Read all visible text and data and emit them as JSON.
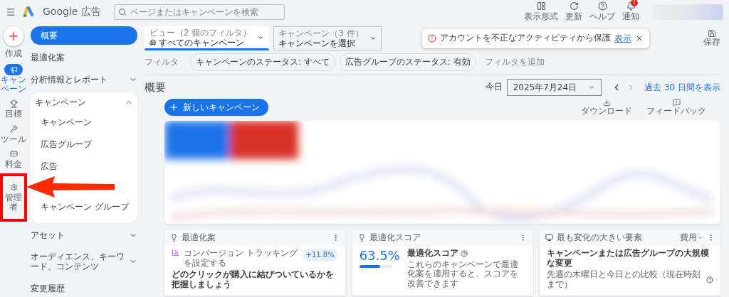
{
  "header": {
    "brand": "Google 広告",
    "search_placeholder": "ページまたはキャンペーンを検索",
    "actions": [
      {
        "label": "表示形式"
      },
      {
        "label": "更新"
      },
      {
        "label": "ヘルプ"
      },
      {
        "label": "通知",
        "badge": "!"
      }
    ]
  },
  "create": {
    "label": "作成"
  },
  "rail": [
    {
      "label": "キャンペーン",
      "selected": true,
      "annotated": false
    },
    {
      "label": "目標",
      "selected": false,
      "annotated": false
    },
    {
      "label": "ツール",
      "selected": false,
      "annotated": false
    },
    {
      "label": "料金",
      "selected": false,
      "annotated": false
    },
    {
      "label": "管理者",
      "selected": false,
      "annotated": true
    }
  ],
  "nav": [
    {
      "label": "概要",
      "kind": "item",
      "selected": true
    },
    {
      "label": "最適化案",
      "kind": "item",
      "selected": false
    },
    {
      "label": "分析情報とレポート",
      "kind": "group",
      "expanded": false,
      "selected": false
    },
    {
      "label": "キャンペーン",
      "kind": "group",
      "expanded": true,
      "selected": false,
      "children": [
        {
          "label": "キャンペーン",
          "selected": false
        },
        {
          "label": "広告グループ",
          "selected": false
        },
        {
          "label": "広告",
          "selected": false
        },
        {
          "label": "キャンペーン グループ",
          "selected": false
        }
      ]
    },
    {
      "label": "アセット",
      "kind": "group",
      "expanded": false,
      "selected": false
    },
    {
      "label": "オーディエンス、キーワード、コンテンツ",
      "kind": "group",
      "expanded": false,
      "selected": false
    },
    {
      "label": "変更履歴",
      "kind": "item",
      "selected": false
    }
  ],
  "toolbar": {
    "view": {
      "label": "ビュー（2 個のフィルタ）",
      "value": "すべてのキャンペーン"
    },
    "campaign": {
      "label": "キャンペーン（3 件）",
      "value": "キャンペーンを選択"
    },
    "save": "保存"
  },
  "alert": {
    "text": "アカウントを不正なアクティビティから保護",
    "link": "表示"
  },
  "filters": {
    "label": "フィルタ",
    "chips": [
      "キャンペーンのステータス: すべて",
      "広告グループのステータス: 有効"
    ],
    "add": "フィルタを追加"
  },
  "page": {
    "title": "概要",
    "date_label": "今日",
    "date": "2025年7月24日",
    "range_link": "過去 30 日間を表示"
  },
  "actions": {
    "new_campaign": "新しいキャンペーン",
    "download": "ダウンロード",
    "feedback": "フィードバック"
  },
  "cards": [
    {
      "kind": "recommendation",
      "title": "最適化案",
      "item": "コンバージョン トラッキングを設定する",
      "badge": "+11.8%",
      "headline": "どのクリックが購入に結びついているかを把握しましょう"
    },
    {
      "kind": "score",
      "title": "最適化スコア",
      "score": "63.5%",
      "level": 0.635,
      "heading": "最適化スコア",
      "description": "これらのキャンペーンで最適化案を適用すると、スコアを改善できます"
    },
    {
      "kind": "changes",
      "title": "最も変化の大きい要素",
      "menu": "費用",
      "heading": "キャンペーンまたは広告グループの大規模な変更",
      "description": "先週の木曜日と今日との比較（現在時刻まで）"
    }
  ]
}
